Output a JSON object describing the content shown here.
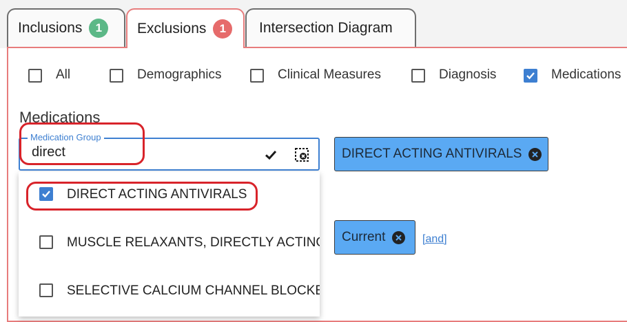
{
  "tabs": [
    {
      "label": "Inclusions",
      "badge": "1",
      "badge_color": "#5cb887"
    },
    {
      "label": "Exclusions",
      "badge": "1",
      "badge_color": "#e66b6b"
    },
    {
      "label": "Intersection Diagram"
    }
  ],
  "categories": [
    {
      "label": "All",
      "checked": false
    },
    {
      "label": "Demographics",
      "checked": false
    },
    {
      "label": "Clinical Measures",
      "checked": false
    },
    {
      "label": "Diagnosis",
      "checked": false
    },
    {
      "label": "Medications",
      "checked": true
    }
  ],
  "section": {
    "title": "Medications"
  },
  "search": {
    "legend": "Medication Group",
    "value": "direct"
  },
  "dropdown": {
    "options": [
      {
        "label": "DIRECT ACTING ANTIVIRALS",
        "checked": true
      },
      {
        "label": "MUSCLE RELAXANTS, DIRECTLY ACTING",
        "checked": false
      },
      {
        "label": "SELECTIVE CALCIUM CHANNEL BLOCKERS",
        "checked": false
      }
    ]
  },
  "chips": {
    "group": "DIRECT ACTING ANTIVIRALS",
    "status": "Current"
  },
  "and_link": "[and]",
  "colors": {
    "accent": "#3d7fd1",
    "chip": "#5aa9f3",
    "active_tab_border": "#e77c7c",
    "annotation": "#d8232a"
  }
}
